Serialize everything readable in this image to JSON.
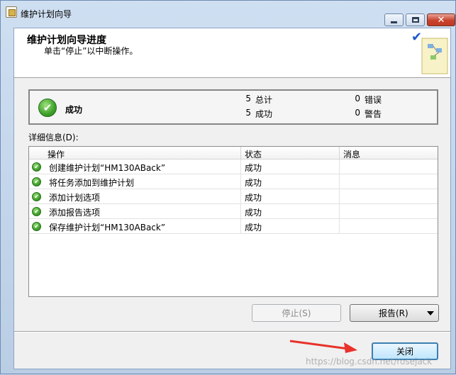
{
  "window": {
    "title": "维护计划向导",
    "minimize_glyph": "",
    "close_glyph": "✕"
  },
  "header": {
    "title": "维护计划向导进度",
    "subtitle": "单击“停止”以中断操作。",
    "check_glyph": "✔"
  },
  "summary": {
    "status": "成功",
    "icon_glyph": "✔",
    "total_count": "5",
    "total_label": "总计",
    "success_count": "5",
    "success_label": "成功",
    "error_count": "0",
    "error_label": "错误",
    "warning_count": "0",
    "warning_label": "警告"
  },
  "details": {
    "label": "详细信息(D):",
    "columns": [
      "操作",
      "状态",
      "消息"
    ],
    "rows": [
      {
        "action": "创建维护计划“HM130ABack”",
        "status": "成功",
        "message": ""
      },
      {
        "action": "将任务添加到维护计划",
        "status": "成功",
        "message": ""
      },
      {
        "action": "添加计划选项",
        "status": "成功",
        "message": ""
      },
      {
        "action": "添加报告选项",
        "status": "成功",
        "message": ""
      },
      {
        "action": "保存维护计划“HM130ABack”",
        "status": "成功",
        "message": ""
      }
    ],
    "row_icon_glyph": "✔"
  },
  "buttons": {
    "stop": "停止(S)",
    "report": "报告(R)",
    "close": "关闭"
  },
  "colors": {
    "accent_blue": "#1d59c6",
    "success_green": "#3ea12a",
    "annotation_red": "#e8322a"
  },
  "watermark": "https://blog.csdn.net/rosejack"
}
